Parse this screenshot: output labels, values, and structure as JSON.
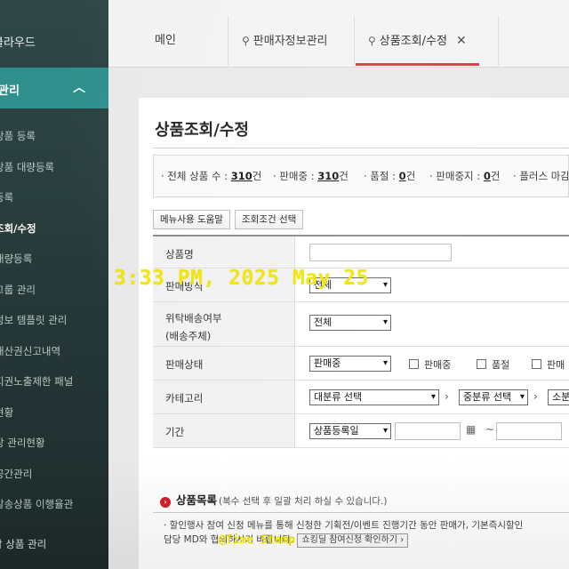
{
  "sidebar": {
    "top_label": "클라우드",
    "section_label": "관리",
    "items": [
      {
        "label": "상품 등록"
      },
      {
        "label": "상품 대량등록"
      },
      {
        "label": "등록"
      },
      {
        "label": "조회/수정",
        "active": true
      },
      {
        "label": "대량등록"
      },
      {
        "label": "그룹 관리"
      },
      {
        "label": "정보 템플릿 관리"
      },
      {
        "label": "재산권신고내역"
      },
      {
        "label": "지권노출제한 패널"
      },
      {
        "label": "현황"
      },
      {
        "label": "장 관리현황"
      },
      {
        "label": "공간관리"
      },
      {
        "label": "발송상품 이행율관"
      }
    ],
    "bottom_label": "합 상품 관리"
  },
  "tabs": [
    {
      "label": "메인"
    },
    {
      "label": "판매자정보관리"
    },
    {
      "label": "상품조회/수정",
      "active": true
    }
  ],
  "page": {
    "title": "상품조회/수정"
  },
  "stats": {
    "total_label": "· 전체 상품 수 : ",
    "total_value": "310",
    "total_unit": "건",
    "selling_label": "· 판매중 : ",
    "selling_value": "310",
    "selling_unit": "건",
    "soldout_label": "· 품절 : ",
    "soldout_value": "0",
    "soldout_unit": "건",
    "stopped_label": "· 판매중지 : ",
    "stopped_value": "0",
    "stopped_unit": "건",
    "plus_label": "· 플러스 마감"
  },
  "buttons": {
    "help": "메뉴사용 도움말",
    "search_condition": "조회조건 선택"
  },
  "form": {
    "product_name_label": "상품명",
    "sale_method_label": "판매방식",
    "sale_method_value": "전체",
    "consign_label_1": "위탁배송여부",
    "consign_label_2": "(배송주체)",
    "consign_value": "전체",
    "sale_status_label": "판매상태",
    "sale_status_value": "판매중",
    "status_checks": [
      "판매중",
      "품절",
      "판매"
    ],
    "category_label": "카테고리",
    "category_large": "대분류 선택",
    "category_medium": "중분류 선택",
    "category_small": "소분",
    "period_label": "기간",
    "period_type": "상품등록일",
    "tilde": "~"
  },
  "product_list": {
    "title": "상품목록",
    "subtitle": "(복수 선택 후 일괄 처리 하실 수 있습니다.)",
    "notice_line1": "· 할인행사 참여 신청 메뉴를 통해 신청한 기획전/이벤트 진행기간 동안 판매가, 기본즉시할인",
    "notice_line2": "  담당 MD와 협의하시기 바랍니다.",
    "notice_button": "쇼킹딜 참여신청 확인하기 ›"
  },
  "overlay": {
    "timestamp": "3:33 PM, 2025 May 25",
    "stamp_label": "@Time Stamp"
  }
}
